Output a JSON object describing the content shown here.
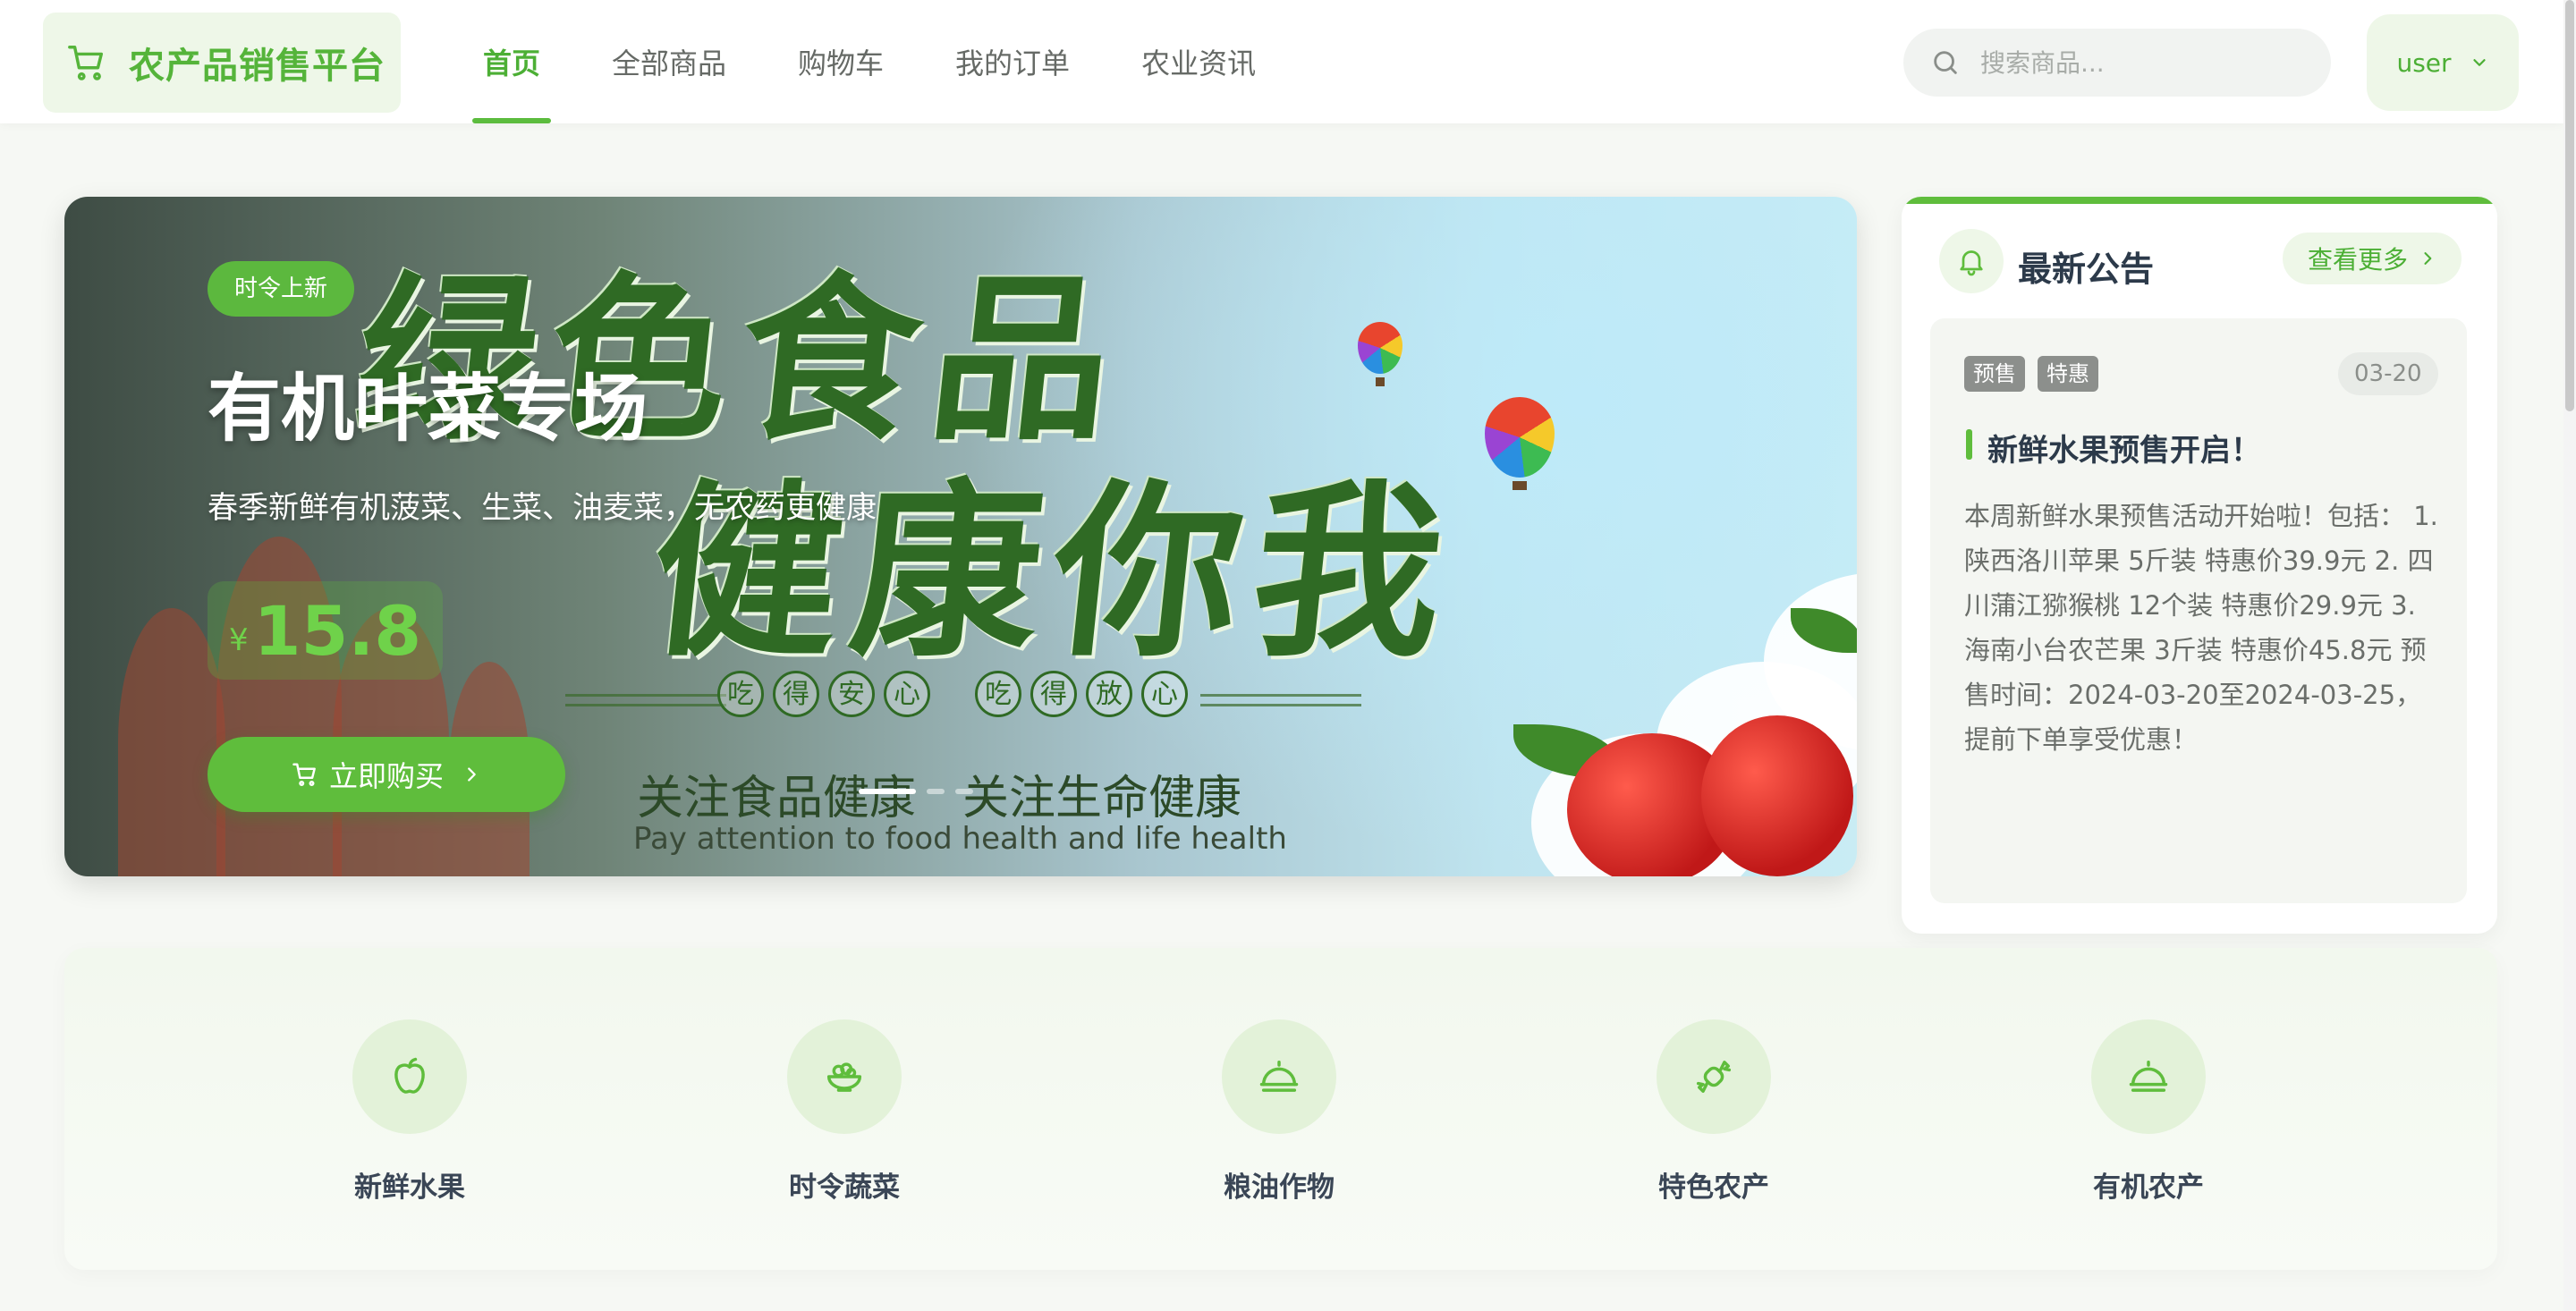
{
  "header": {
    "brand": "农产品销售平台",
    "nav": [
      {
        "label": "首页",
        "active": true
      },
      {
        "label": "全部商品",
        "active": false
      },
      {
        "label": "购物车",
        "active": false
      },
      {
        "label": "我的订单",
        "active": false
      },
      {
        "label": "农业资讯",
        "active": false
      }
    ],
    "search_placeholder": "搜索商品...",
    "user_label": "user"
  },
  "banner": {
    "tag": "时令上新",
    "title": "有机叶菜专场",
    "subtitle": "春季新鲜有机菠菜、生菜、油麦菜，无农药更健康",
    "currency": "¥",
    "price": "15.8",
    "buy_label": "立即购买",
    "image_text": {
      "line1": "绿色食品",
      "line2": "健康你我",
      "motto": [
        "吃",
        "得",
        "安",
        "心",
        "吃",
        "得",
        "放",
        "心"
      ],
      "slogan": "关注食品健康　关注生命健康",
      "slogan_en": "Pay attention to food health and life health"
    },
    "slide_count": 3,
    "active_slide": 0
  },
  "notice": {
    "title": "最新公告",
    "more_label": "查看更多",
    "badges": [
      "预售",
      "特惠"
    ],
    "date": "03-20",
    "item_title": "新鲜水果预售开启！",
    "item_content": "本周新鲜水果预售活动开始啦！包括： 1. 陕西洛川苹果 5斤装 特惠价39.9元 2. 四川蒲江猕猴桃 12个装 特惠价29.9元 3. 海南小台农芒果 3斤装 特惠价45.8元 预售时间：2024-03-20至2024-03-25，提前下单享受优惠！"
  },
  "categories": [
    {
      "label": "新鲜水果",
      "icon": "apple-icon"
    },
    {
      "label": "时令蔬菜",
      "icon": "bowl-icon"
    },
    {
      "label": "粮油作物",
      "icon": "dish-icon"
    },
    {
      "label": "特色农产",
      "icon": "candy-icon"
    },
    {
      "label": "有机农产",
      "icon": "dish-icon"
    }
  ],
  "colors": {
    "accent": "#5fbd3c",
    "accent_text": "#4caf35",
    "accent_soft": "#eef7e8"
  }
}
